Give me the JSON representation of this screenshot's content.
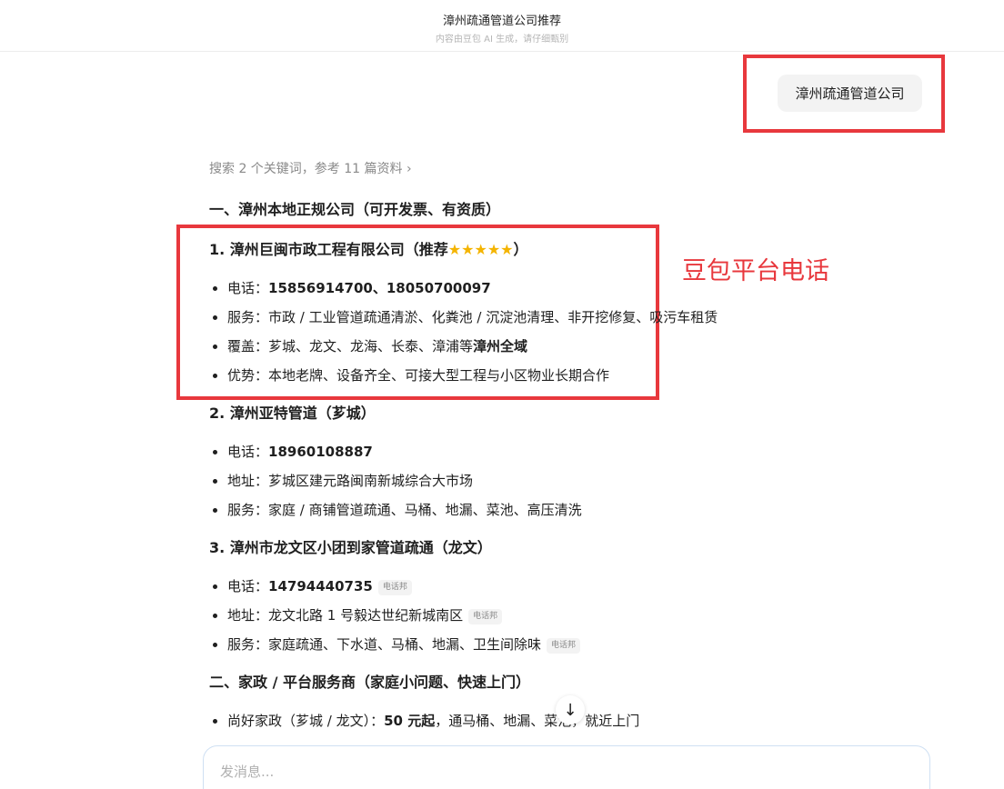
{
  "header": {
    "title": "漳州疏通管道公司推荐",
    "subtitle": "内容由豆包 AI 生成，请仔细甄别"
  },
  "user_message": "漳州疏通管道公司",
  "annotation": "豆包平台电话",
  "search_meta": "搜索 2 个关键词，参考 11 篇资料 ›",
  "sections": [
    {
      "heading": "一、漳州本地正规公司（可开发票、有资质）",
      "items": [
        {
          "title": "1. 漳州巨闽市政工程有限公司（推荐",
          "stars": "★★★★★",
          "title_end": "）",
          "rating": 5,
          "lines": [
            {
              "label": "电话：",
              "value": "15856914700、18050700097"
            },
            {
              "label": "服务：",
              "value": "市政 / 工业管道疏通清淤、化粪池 / 沉淀池清理、非开挖修复、吸污车租赁"
            },
            {
              "label": "覆盖：",
              "value": "芗城、龙文、龙海、长泰、漳浦等",
              "value_bold": "漳州全域"
            },
            {
              "label": "优势：",
              "value": "本地老牌、设备齐全、可接大型工程与小区物业长期合作"
            }
          ]
        },
        {
          "title": "2. 漳州亚特管道（芗城）",
          "lines": [
            {
              "label": "电话：",
              "value": "18960108887"
            },
            {
              "label": "地址：",
              "value": "芗城区建元路闽南新城综合大市场"
            },
            {
              "label": "服务：",
              "value": "家庭 / 商铺管道疏通、马桶、地漏、菜池、高压清洗"
            }
          ]
        },
        {
          "title": "3. 漳州市龙文区小团到家管道疏通（龙文）",
          "lines": [
            {
              "label": "电话：",
              "value": "14794440735",
              "tag": "电话邦"
            },
            {
              "label": "地址：",
              "value": "龙文北路 1 号毅达世纪新城南区",
              "tag": "电话邦"
            },
            {
              "label": "服务：",
              "value": "家庭疏通、下水道、马桶、地漏、卫生间除味",
              "tag": "电话邦"
            }
          ]
        }
      ]
    },
    {
      "heading": "二、家政 / 平台服务商（家庭小问题、快速上门）",
      "items": [
        {
          "lines": [
            {
              "label": "尚好家政（芗城 / 龙文）：",
              "value_bold": "50 元起",
              "value": "，通马桶、地漏、菜池，就近上门"
            }
          ]
        }
      ]
    }
  ],
  "composer": {
    "placeholder": "发消息..."
  },
  "icons": {
    "scroll_down": "arrow-down-icon",
    "chevron": "chevron-right-icon"
  },
  "colors": {
    "annotation_red": "#e8383d",
    "star_gold": "#f4b400"
  }
}
